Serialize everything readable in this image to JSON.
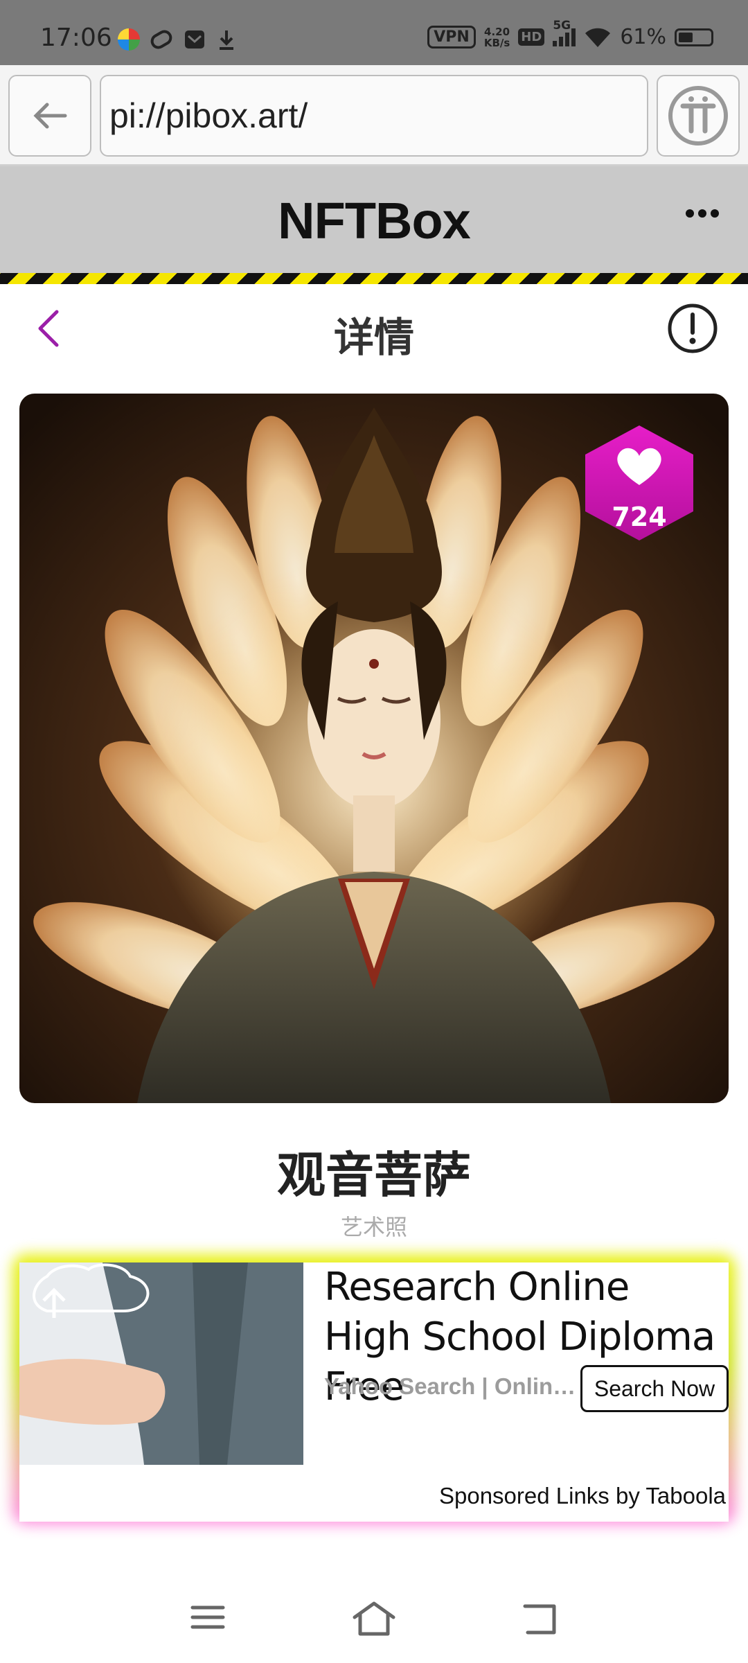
{
  "status_bar": {
    "time": "17:06",
    "vpn": "VPN",
    "speed_value": "4.20",
    "speed_unit": "KB/s",
    "hd": "HD",
    "network": "5G",
    "battery": "61%"
  },
  "browser": {
    "url": "pi://pibox.art/",
    "back_icon": "arrow-left-icon",
    "pi_icon": "pi-logo-icon"
  },
  "app": {
    "name": "NFTBox",
    "more_icon": "more-dots-icon"
  },
  "detail": {
    "title": "详情",
    "back_icon": "chevron-left-icon",
    "info_icon": "exclamation-circle-icon",
    "accent_color": "#9b1fa8"
  },
  "artwork": {
    "likes": "724",
    "like_color": "#c80fc2",
    "title": "观音菩萨",
    "subtitle": "艺术照"
  },
  "ad": {
    "headline": "Research Online High School Diploma Free",
    "source": "Yahoo Search | Online High School Diploma",
    "cta": "Search Now",
    "sponsor": "Sponsored Links by Taboola"
  },
  "system_nav": {
    "menu_icon": "menu-icon",
    "home_icon": "home-icon",
    "back_icon": "back-icon"
  }
}
